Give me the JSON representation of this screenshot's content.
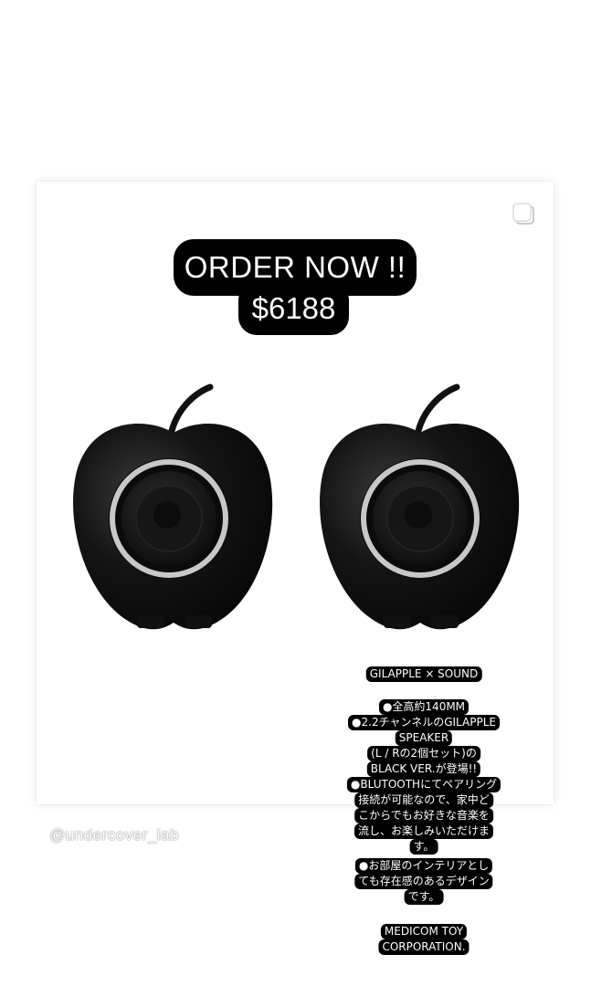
{
  "post": {
    "headline": "ORDER NOW !!",
    "price": "$6188"
  },
  "watermark": "@undercover_lab",
  "description": {
    "title": "GILAPPLE × SOUND",
    "lines": [
      "●全高約140MM",
      "●2.2チャンネルのGILAPPLE",
      "SPEAKER",
      "(L / Rの2個セット)の",
      "BLACK VER.が登場!!",
      "●BLUTOOTHにてペアリング",
      "接続が可能なので、家中ど",
      "こからでもお好きな音楽を",
      "流し、お楽しみいただけま",
      "す。",
      "●お部屋のインテリアとし",
      "ても存在感のあるデザイン",
      "です。"
    ],
    "maker": [
      "MEDICOM TOY",
      "CORPORATION."
    ]
  },
  "icons": {
    "corner": "multi-photo-icon",
    "product": "gilapple-speaker"
  },
  "colors": {
    "pill_bg": "#000000",
    "pill_text": "#ffffff",
    "ring": "#c8c8c8"
  }
}
